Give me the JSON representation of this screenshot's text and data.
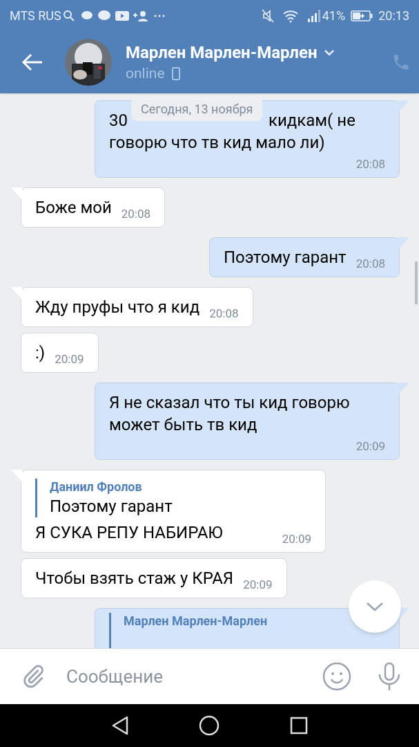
{
  "status_bar": {
    "carrier": "MTS RUS",
    "battery": "41%",
    "time": "20:13"
  },
  "header": {
    "name": "Марлен Марлен-Марлен",
    "presence": "online"
  },
  "date_divider": "Сегодня, 13 ноября",
  "messages": [
    {
      "kind": "partly_covered",
      "outgoing": true,
      "tail": true,
      "parts": [
        "30",
        "кидкам( не",
        "говорю что тв кид мало ли)"
      ],
      "time": "20:08"
    },
    {
      "kind": "text",
      "outgoing": false,
      "tail": true,
      "text": "Боже мой",
      "time": "20:08"
    },
    {
      "kind": "text",
      "outgoing": true,
      "tail": true,
      "text": "Поэтому гарант",
      "time": "20:08"
    },
    {
      "kind": "text",
      "outgoing": false,
      "tail": true,
      "text": "Жду пруфы что я кид",
      "time": "20:08"
    },
    {
      "kind": "text",
      "outgoing": false,
      "tail": false,
      "text": ":)",
      "time": "20:09"
    },
    {
      "kind": "text",
      "outgoing": true,
      "tail": true,
      "text": "Я не сказал что ты кид говорю может быть тв кид",
      "time": "20:09"
    },
    {
      "kind": "reply",
      "outgoing": false,
      "tail": true,
      "reply": {
        "author": "Даниил Фролов",
        "text": "Поэтому гарант"
      },
      "text": "Я СУКА РЕПУ НАБИРАЮ",
      "time": "20:09"
    },
    {
      "kind": "text",
      "outgoing": false,
      "tail": false,
      "text": "Чтобы взять стаж у КРАЯ",
      "time": "20:09"
    },
    {
      "kind": "cut_reply",
      "outgoing": true,
      "tail": true,
      "reply": {
        "author": "Марлен Марлен-Марлен"
      }
    }
  ],
  "composer": {
    "placeholder": "Сообщение"
  }
}
